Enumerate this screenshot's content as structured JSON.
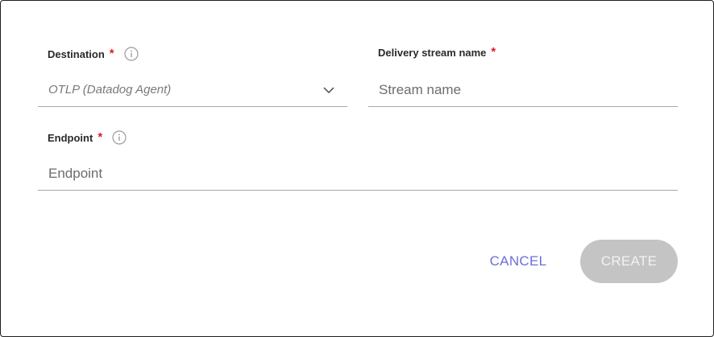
{
  "form": {
    "destination": {
      "label": "Destination",
      "required_mark": "*",
      "info_icon": "info-circle-icon",
      "value": "OTLP (Datadog Agent)",
      "dropdown_icon": "chevron-down-icon"
    },
    "stream_name": {
      "label": "Delivery stream name",
      "required_mark": "*",
      "placeholder": "Stream name"
    },
    "endpoint": {
      "label": "Endpoint",
      "required_mark": "*",
      "info_icon": "info-circle-icon",
      "placeholder": "Endpoint"
    }
  },
  "actions": {
    "cancel_label": "CANCEL",
    "create_label": "CREATE",
    "create_disabled": true
  },
  "colors": {
    "required": "#e01b24",
    "cancel_text": "#6b6fd8",
    "create_bg_disabled": "#c4c4c4",
    "underline": "#a8a8a8"
  }
}
